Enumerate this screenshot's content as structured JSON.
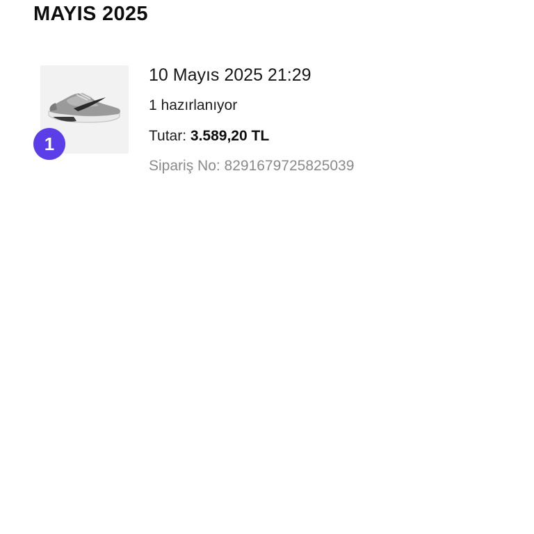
{
  "section": {
    "month_title": "MAYIS 2025"
  },
  "orders": [
    {
      "date": "10 Mayıs 2025 21:29",
      "status": "1 hazırlanıyor",
      "total_label": "Tutar:",
      "total_amount": "3.589,20 TL",
      "order_number": "Sipariş No: 8291679725825039",
      "item_count_badge": "1",
      "product_image": "sneaker-image"
    }
  ],
  "colors": {
    "badge": "#5b3ee8",
    "muted_text": "#8a8a8a",
    "thumb_bg": "#f2f2f2"
  }
}
